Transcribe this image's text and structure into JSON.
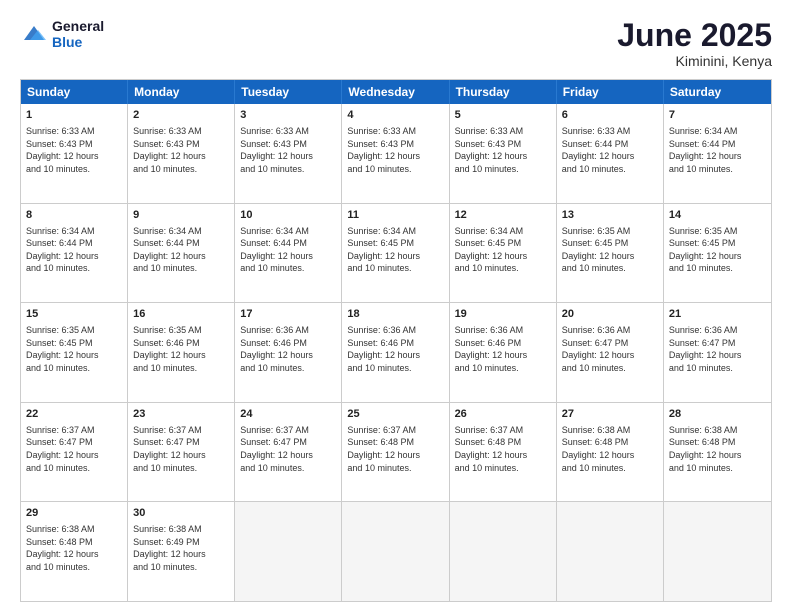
{
  "logo": {
    "line1": "General",
    "line2": "Blue"
  },
  "title": "June 2025",
  "subtitle": "Kiminini, Kenya",
  "header_days": [
    "Sunday",
    "Monday",
    "Tuesday",
    "Wednesday",
    "Thursday",
    "Friday",
    "Saturday"
  ],
  "weeks": [
    [
      {
        "day": "1",
        "lines": [
          "Sunrise: 6:33 AM",
          "Sunset: 6:43 PM",
          "Daylight: 12 hours",
          "and 10 minutes."
        ]
      },
      {
        "day": "2",
        "lines": [
          "Sunrise: 6:33 AM",
          "Sunset: 6:43 PM",
          "Daylight: 12 hours",
          "and 10 minutes."
        ]
      },
      {
        "day": "3",
        "lines": [
          "Sunrise: 6:33 AM",
          "Sunset: 6:43 PM",
          "Daylight: 12 hours",
          "and 10 minutes."
        ]
      },
      {
        "day": "4",
        "lines": [
          "Sunrise: 6:33 AM",
          "Sunset: 6:43 PM",
          "Daylight: 12 hours",
          "and 10 minutes."
        ]
      },
      {
        "day": "5",
        "lines": [
          "Sunrise: 6:33 AM",
          "Sunset: 6:43 PM",
          "Daylight: 12 hours",
          "and 10 minutes."
        ]
      },
      {
        "day": "6",
        "lines": [
          "Sunrise: 6:33 AM",
          "Sunset: 6:44 PM",
          "Daylight: 12 hours",
          "and 10 minutes."
        ]
      },
      {
        "day": "7",
        "lines": [
          "Sunrise: 6:34 AM",
          "Sunset: 6:44 PM",
          "Daylight: 12 hours",
          "and 10 minutes."
        ]
      }
    ],
    [
      {
        "day": "8",
        "lines": [
          "Sunrise: 6:34 AM",
          "Sunset: 6:44 PM",
          "Daylight: 12 hours",
          "and 10 minutes."
        ]
      },
      {
        "day": "9",
        "lines": [
          "Sunrise: 6:34 AM",
          "Sunset: 6:44 PM",
          "Daylight: 12 hours",
          "and 10 minutes."
        ]
      },
      {
        "day": "10",
        "lines": [
          "Sunrise: 6:34 AM",
          "Sunset: 6:44 PM",
          "Daylight: 12 hours",
          "and 10 minutes."
        ]
      },
      {
        "day": "11",
        "lines": [
          "Sunrise: 6:34 AM",
          "Sunset: 6:45 PM",
          "Daylight: 12 hours",
          "and 10 minutes."
        ]
      },
      {
        "day": "12",
        "lines": [
          "Sunrise: 6:34 AM",
          "Sunset: 6:45 PM",
          "Daylight: 12 hours",
          "and 10 minutes."
        ]
      },
      {
        "day": "13",
        "lines": [
          "Sunrise: 6:35 AM",
          "Sunset: 6:45 PM",
          "Daylight: 12 hours",
          "and 10 minutes."
        ]
      },
      {
        "day": "14",
        "lines": [
          "Sunrise: 6:35 AM",
          "Sunset: 6:45 PM",
          "Daylight: 12 hours",
          "and 10 minutes."
        ]
      }
    ],
    [
      {
        "day": "15",
        "lines": [
          "Sunrise: 6:35 AM",
          "Sunset: 6:45 PM",
          "Daylight: 12 hours",
          "and 10 minutes."
        ]
      },
      {
        "day": "16",
        "lines": [
          "Sunrise: 6:35 AM",
          "Sunset: 6:46 PM",
          "Daylight: 12 hours",
          "and 10 minutes."
        ]
      },
      {
        "day": "17",
        "lines": [
          "Sunrise: 6:36 AM",
          "Sunset: 6:46 PM",
          "Daylight: 12 hours",
          "and 10 minutes."
        ]
      },
      {
        "day": "18",
        "lines": [
          "Sunrise: 6:36 AM",
          "Sunset: 6:46 PM",
          "Daylight: 12 hours",
          "and 10 minutes."
        ]
      },
      {
        "day": "19",
        "lines": [
          "Sunrise: 6:36 AM",
          "Sunset: 6:46 PM",
          "Daylight: 12 hours",
          "and 10 minutes."
        ]
      },
      {
        "day": "20",
        "lines": [
          "Sunrise: 6:36 AM",
          "Sunset: 6:47 PM",
          "Daylight: 12 hours",
          "and 10 minutes."
        ]
      },
      {
        "day": "21",
        "lines": [
          "Sunrise: 6:36 AM",
          "Sunset: 6:47 PM",
          "Daylight: 12 hours",
          "and 10 minutes."
        ]
      }
    ],
    [
      {
        "day": "22",
        "lines": [
          "Sunrise: 6:37 AM",
          "Sunset: 6:47 PM",
          "Daylight: 12 hours",
          "and 10 minutes."
        ]
      },
      {
        "day": "23",
        "lines": [
          "Sunrise: 6:37 AM",
          "Sunset: 6:47 PM",
          "Daylight: 12 hours",
          "and 10 minutes."
        ]
      },
      {
        "day": "24",
        "lines": [
          "Sunrise: 6:37 AM",
          "Sunset: 6:47 PM",
          "Daylight: 12 hours",
          "and 10 minutes."
        ]
      },
      {
        "day": "25",
        "lines": [
          "Sunrise: 6:37 AM",
          "Sunset: 6:48 PM",
          "Daylight: 12 hours",
          "and 10 minutes."
        ]
      },
      {
        "day": "26",
        "lines": [
          "Sunrise: 6:37 AM",
          "Sunset: 6:48 PM",
          "Daylight: 12 hours",
          "and 10 minutes."
        ]
      },
      {
        "day": "27",
        "lines": [
          "Sunrise: 6:38 AM",
          "Sunset: 6:48 PM",
          "Daylight: 12 hours",
          "and 10 minutes."
        ]
      },
      {
        "day": "28",
        "lines": [
          "Sunrise: 6:38 AM",
          "Sunset: 6:48 PM",
          "Daylight: 12 hours",
          "and 10 minutes."
        ]
      }
    ],
    [
      {
        "day": "29",
        "lines": [
          "Sunrise: 6:38 AM",
          "Sunset: 6:48 PM",
          "Daylight: 12 hours",
          "and 10 minutes."
        ]
      },
      {
        "day": "30",
        "lines": [
          "Sunrise: 6:38 AM",
          "Sunset: 6:49 PM",
          "Daylight: 12 hours",
          "and 10 minutes."
        ]
      },
      {
        "day": "",
        "lines": []
      },
      {
        "day": "",
        "lines": []
      },
      {
        "day": "",
        "lines": []
      },
      {
        "day": "",
        "lines": []
      },
      {
        "day": "",
        "lines": []
      }
    ]
  ]
}
